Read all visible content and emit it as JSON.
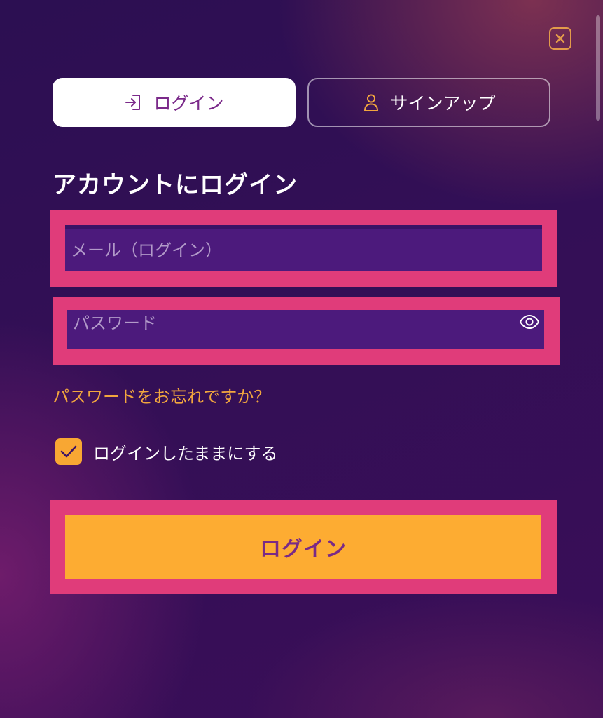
{
  "tabs": {
    "login": {
      "label": "ログイン",
      "icon": "login-icon"
    },
    "signup": {
      "label": "サインアップ",
      "icon": "user-icon"
    }
  },
  "title": "アカウントにログイン",
  "form": {
    "email": {
      "placeholder": "メール（ログイン）",
      "value": ""
    },
    "password": {
      "placeholder": "パスワード",
      "value": "",
      "toggle_icon": "eye-icon"
    },
    "forgot_password": "パスワードをお忘れですか？",
    "remember_me": {
      "label": "ログインしたままにする",
      "checked": true
    },
    "submit_label": "ログイン"
  },
  "colors": {
    "accent": "#fdac32",
    "highlight": "#e03c7a",
    "field_bg": "#4c1a7c",
    "brand_purple": "#7b2a8a"
  }
}
